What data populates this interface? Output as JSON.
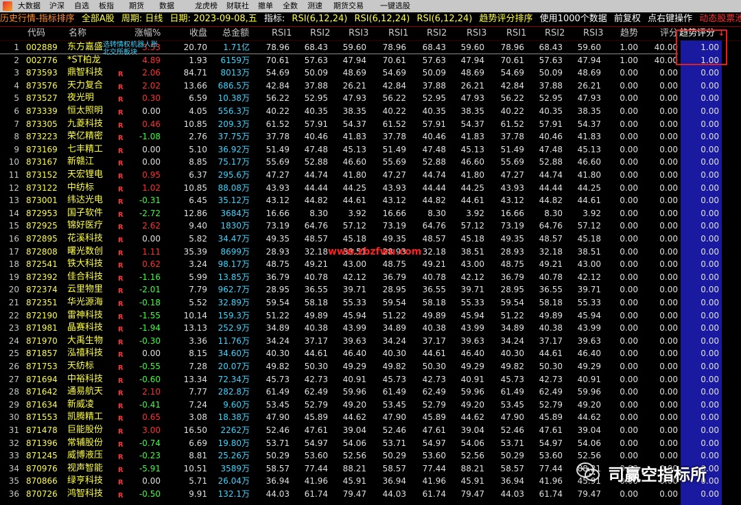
{
  "menu": [
    "大数据",
    "沪深",
    "自选",
    "板指",
    "期货",
    "数据",
    "龙虎榜",
    "财联社",
    "撤单",
    "全数",
    "测速",
    "期货交易",
    "一键选股"
  ],
  "title_bar": {
    "history": "历史行情-指标排序",
    "all_stocks": "全部A股",
    "period": "周期: 日线",
    "date": "日期: 2023-09-08,五",
    "indicator_label": "指标:",
    "ind1": "RSI(6,12,24)",
    "ind2": "RSI(6,12,24)",
    "ind3": "RSI(6,12,24)",
    "sort": "趋势评分排序",
    "use": "使用1000个数据",
    "adj": "前复权",
    "click": "点右键操作",
    "dynamic": "动态股票池"
  },
  "headers": {
    "code": "代码",
    "name": "名称",
    "change": "涨幅%",
    "close": "收盘",
    "amount": "总金额",
    "r1": "RSI1",
    "r2": "RSI2",
    "r3": "RSI3",
    "r4": "RSI1",
    "r5": "RSI2",
    "r6": "RSI3",
    "r7": "RSI1",
    "r8": "RSI2",
    "r9": "RSI3",
    "trend": "趋势",
    "score": "评分",
    "trend_score": "趋势评分",
    "sort_arrow": "↓"
  },
  "popup": {
    "line1": "选转情权机器人账",
    "line2": "北交所板块"
  },
  "watermark": "www.zbzfwu.com",
  "brand": "司赢空指标所",
  "colors": {
    "up": "#ff3030",
    "down": "#3aff3a",
    "highlight_col": "#1a1aa0",
    "code": "#ffff3a",
    "amount": "#3ad6ff"
  },
  "rows": [
    {
      "idx": "1",
      "code": "002889",
      "name": "东方嘉盛",
      "r": "",
      "chg": "3.53",
      "dir": "up",
      "close": "20.70",
      "amt": "1.71亿",
      "v": [
        "78.96",
        "68.43",
        "59.60",
        "78.96",
        "68.43",
        "59.60",
        "78.96",
        "68.43",
        "59.60"
      ],
      "trend": "1.00",
      "score": "40.00",
      "ts": "1.00"
    },
    {
      "idx": "2",
      "code": "002776",
      "name": "*ST柏龙",
      "r": "",
      "chg": "4.89",
      "dir": "up",
      "close": "1.93",
      "amt": "6159万",
      "v": [
        "70.61",
        "57.63",
        "47.94",
        "70.61",
        "57.63",
        "47.94",
        "70.61",
        "57.63",
        "47.94"
      ],
      "trend": "1.00",
      "score": "40.00",
      "ts": "1.00"
    },
    {
      "idx": "3",
      "code": "873593",
      "name": "鼎智科技",
      "r": "R",
      "chg": "2.06",
      "dir": "up",
      "close": "84.71",
      "amt": "8013万",
      "v": [
        "54.69",
        "50.09",
        "48.69",
        "54.69",
        "50.09",
        "48.69",
        "54.69",
        "50.09",
        "48.69"
      ],
      "trend": "0.00",
      "score": "0.00",
      "ts": "0.00"
    },
    {
      "idx": "4",
      "code": "873576",
      "name": "天力复合",
      "r": "R",
      "chg": "2.02",
      "dir": "up",
      "close": "13.66",
      "amt": "686.5万",
      "v": [
        "42.84",
        "37.88",
        "26.21",
        "42.84",
        "37.88",
        "26.21",
        "42.84",
        "37.88",
        "26.21"
      ],
      "trend": "0.00",
      "score": "0.00",
      "ts": "0.00"
    },
    {
      "idx": "5",
      "code": "873527",
      "name": "夜光明",
      "r": "R",
      "chg": "0.30",
      "dir": "up",
      "close": "6.59",
      "amt": "10.38万",
      "v": [
        "56.22",
        "52.95",
        "47.93",
        "56.22",
        "52.95",
        "47.93",
        "56.22",
        "52.95",
        "47.93"
      ],
      "trend": "0.00",
      "score": "0.00",
      "ts": "0.00"
    },
    {
      "idx": "6",
      "code": "873339",
      "name": "恒太照明",
      "r": "R",
      "chg": "0.00",
      "dir": "flat",
      "close": "4.05",
      "amt": "556.3万",
      "v": [
        "40.22",
        "40.35",
        "38.35",
        "40.22",
        "40.35",
        "38.35",
        "40.22",
        "40.35",
        "38.35"
      ],
      "trend": "0.00",
      "score": "0.00",
      "ts": "0.00"
    },
    {
      "idx": "7",
      "code": "873305",
      "name": "九菱科技",
      "r": "R",
      "chg": "0.46",
      "dir": "up",
      "close": "10.85",
      "amt": "209.3万",
      "v": [
        "61.52",
        "57.91",
        "54.37",
        "61.52",
        "57.91",
        "54.37",
        "61.52",
        "57.91",
        "54.37"
      ],
      "trend": "0.00",
      "score": "0.00",
      "ts": "0.00"
    },
    {
      "idx": "8",
      "code": "873223",
      "name": "荣亿精密",
      "r": "R",
      "chg": "-1.08",
      "dir": "down",
      "close": "2.76",
      "amt": "37.75万",
      "v": [
        "37.78",
        "40.46",
        "41.83",
        "37.78",
        "40.46",
        "41.83",
        "37.78",
        "40.46",
        "41.83"
      ],
      "trend": "0.00",
      "score": "0.00",
      "ts": "0.00"
    },
    {
      "idx": "9",
      "code": "873169",
      "name": "七丰精工",
      "r": "R",
      "chg": "0.00",
      "dir": "flat",
      "close": "5.10",
      "amt": "36.92万",
      "v": [
        "51.49",
        "47.48",
        "45.13",
        "51.49",
        "47.48",
        "45.13",
        "51.49",
        "47.48",
        "45.13"
      ],
      "trend": "0.00",
      "score": "0.00",
      "ts": "0.00"
    },
    {
      "idx": "10",
      "code": "873167",
      "name": "新赣江",
      "r": "R",
      "chg": "0.00",
      "dir": "flat",
      "close": "8.85",
      "amt": "75.17万",
      "v": [
        "55.69",
        "52.88",
        "46.60",
        "55.69",
        "52.88",
        "46.60",
        "55.69",
        "52.88",
        "46.60"
      ],
      "trend": "0.00",
      "score": "0.00",
      "ts": "0.00"
    },
    {
      "idx": "11",
      "code": "873152",
      "name": "天宏锂电",
      "r": "R",
      "chg": "0.95",
      "dir": "up",
      "close": "6.37",
      "amt": "295.6万",
      "v": [
        "47.27",
        "44.74",
        "41.80",
        "47.27",
        "44.74",
        "41.80",
        "47.27",
        "44.74",
        "41.80"
      ],
      "trend": "0.00",
      "score": "0.00",
      "ts": "0.00"
    },
    {
      "idx": "12",
      "code": "873122",
      "name": "中纺标",
      "r": "R",
      "chg": "1.02",
      "dir": "up",
      "close": "10.85",
      "amt": "88.08万",
      "v": [
        "43.93",
        "44.44",
        "44.25",
        "43.93",
        "44.44",
        "44.25",
        "43.93",
        "44.44",
        "44.25"
      ],
      "trend": "0.00",
      "score": "0.00",
      "ts": "0.00"
    },
    {
      "idx": "13",
      "code": "873001",
      "name": "纬达光电",
      "r": "R",
      "chg": "-0.31",
      "dir": "down",
      "close": "6.45",
      "amt": "35.12万",
      "v": [
        "43.12",
        "44.82",
        "44.61",
        "43.12",
        "44.82",
        "44.61",
        "43.12",
        "44.82",
        "44.61"
      ],
      "trend": "0.00",
      "score": "0.00",
      "ts": "0.00"
    },
    {
      "idx": "14",
      "code": "872953",
      "name": "国子软件",
      "r": "R",
      "chg": "-2.72",
      "dir": "down",
      "close": "12.86",
      "amt": "3684万",
      "v": [
        "16.66",
        "8.30",
        "3.92",
        "16.66",
        "8.30",
        "3.92",
        "16.66",
        "8.30",
        "3.92"
      ],
      "trend": "0.00",
      "score": "0.00",
      "ts": "0.00"
    },
    {
      "idx": "15",
      "code": "872925",
      "name": "锦好医疗",
      "r": "R",
      "chg": "2.62",
      "dir": "up",
      "close": "9.40",
      "amt": "1830万",
      "v": [
        "73.19",
        "64.76",
        "57.12",
        "73.19",
        "64.76",
        "57.12",
        "73.19",
        "64.76",
        "57.12"
      ],
      "trend": "0.00",
      "score": "0.00",
      "ts": "0.00"
    },
    {
      "idx": "16",
      "code": "872895",
      "name": "花溪科技",
      "r": "R",
      "chg": "0.00",
      "dir": "flat",
      "close": "5.82",
      "amt": "34.47万",
      "v": [
        "49.35",
        "48.57",
        "45.18",
        "49.35",
        "48.57",
        "45.18",
        "49.35",
        "48.57",
        "45.18"
      ],
      "trend": "0.00",
      "score": "0.00",
      "ts": "0.00"
    },
    {
      "idx": "17",
      "code": "872808",
      "name": "曙光数创",
      "r": "R",
      "chg": "1.11",
      "dir": "up",
      "close": "35.39",
      "amt": "8699万",
      "v": [
        "28.93",
        "32.18",
        "38.51",
        "28.93",
        "32.18",
        "38.51",
        "28.93",
        "32.18",
        "38.51"
      ],
      "trend": "0.00",
      "score": "0.00",
      "ts": "0.00"
    },
    {
      "idx": "18",
      "code": "872541",
      "name": "铁大科技",
      "r": "R",
      "chg": "0.62",
      "dir": "up",
      "close": "3.24",
      "amt": "98.17万",
      "v": [
        "48.75",
        "49.21",
        "43.00",
        "48.75",
        "49.21",
        "43.00",
        "48.75",
        "49.21",
        "43.00"
      ],
      "trend": "0.00",
      "score": "0.00",
      "ts": "0.00"
    },
    {
      "idx": "19",
      "code": "872392",
      "name": "佳合科技",
      "r": "R",
      "chg": "-1.16",
      "dir": "down",
      "close": "5.99",
      "amt": "13.85万",
      "v": [
        "36.79",
        "40.78",
        "42.12",
        "36.79",
        "40.78",
        "42.12",
        "36.79",
        "40.78",
        "42.12"
      ],
      "trend": "0.00",
      "score": "0.00",
      "ts": "0.00"
    },
    {
      "idx": "20",
      "code": "872374",
      "name": "云里物里",
      "r": "R",
      "chg": "-2.01",
      "dir": "down",
      "close": "7.79",
      "amt": "962.7万",
      "v": [
        "28.95",
        "36.55",
        "39.71",
        "28.95",
        "36.55",
        "39.71",
        "28.95",
        "36.55",
        "39.71"
      ],
      "trend": "0.00",
      "score": "0.00",
      "ts": "0.00"
    },
    {
      "idx": "21",
      "code": "872351",
      "name": "华光源海",
      "r": "R",
      "chg": "-0.18",
      "dir": "down",
      "close": "5.52",
      "amt": "32.89万",
      "v": [
        "59.54",
        "58.18",
        "55.33",
        "59.54",
        "58.18",
        "55.33",
        "59.54",
        "58.18",
        "55.33"
      ],
      "trend": "0.00",
      "score": "0.00",
      "ts": "0.00"
    },
    {
      "idx": "22",
      "code": "872190",
      "name": "雷神科技",
      "r": "R",
      "chg": "-1.55",
      "dir": "down",
      "close": "10.14",
      "amt": "159.3万",
      "v": [
        "51.22",
        "49.89",
        "45.94",
        "51.22",
        "49.89",
        "45.94",
        "51.22",
        "49.89",
        "45.94"
      ],
      "trend": "0.00",
      "score": "0.00",
      "ts": "0.00"
    },
    {
      "idx": "23",
      "code": "871981",
      "name": "晶赛科技",
      "r": "R",
      "chg": "-1.94",
      "dir": "down",
      "close": "13.13",
      "amt": "252.9万",
      "v": [
        "34.89",
        "40.38",
        "43.99",
        "34.89",
        "40.38",
        "43.99",
        "34.89",
        "40.38",
        "43.99"
      ],
      "trend": "0.00",
      "score": "0.00",
      "ts": "0.00"
    },
    {
      "idx": "24",
      "code": "871970",
      "name": "大禹生物",
      "r": "R",
      "chg": "-0.30",
      "dir": "down",
      "close": "3.36",
      "amt": "11.76万",
      "v": [
        "34.24",
        "37.17",
        "39.63",
        "34.24",
        "37.17",
        "39.63",
        "34.24",
        "37.17",
        "39.63"
      ],
      "trend": "0.00",
      "score": "0.00",
      "ts": "0.00"
    },
    {
      "idx": "25",
      "code": "871857",
      "name": "泓禧科技",
      "r": "R",
      "chg": "0.00",
      "dir": "flat",
      "close": "8.15",
      "amt": "34.60万",
      "v": [
        "40.30",
        "44.61",
        "46.40",
        "40.30",
        "44.61",
        "46.40",
        "40.30",
        "44.61",
        "46.40"
      ],
      "trend": "0.00",
      "score": "0.00",
      "ts": "0.00"
    },
    {
      "idx": "26",
      "code": "871753",
      "name": "天纺标",
      "r": "R",
      "chg": "-0.55",
      "dir": "down",
      "close": "7.28",
      "amt": "20.07万",
      "v": [
        "49.82",
        "50.30",
        "49.29",
        "49.82",
        "50.30",
        "49.29",
        "49.82",
        "50.30",
        "49.29"
      ],
      "trend": "0.00",
      "score": "0.00",
      "ts": "0.00"
    },
    {
      "idx": "27",
      "code": "871694",
      "name": "中裕科技",
      "r": "R",
      "chg": "-0.60",
      "dir": "down",
      "close": "13.34",
      "amt": "72.34万",
      "v": [
        "45.73",
        "42.73",
        "40.91",
        "45.73",
        "42.73",
        "40.91",
        "45.73",
        "42.73",
        "40.91"
      ],
      "trend": "0.00",
      "score": "0.00",
      "ts": "0.00"
    },
    {
      "idx": "28",
      "code": "871642",
      "name": "通易航天",
      "r": "R",
      "chg": "2.10",
      "dir": "up",
      "close": "7.77",
      "amt": "282.8万",
      "v": [
        "61.49",
        "62.49",
        "59.96",
        "61.49",
        "62.49",
        "59.96",
        "61.49",
        "62.49",
        "59.96"
      ],
      "trend": "0.00",
      "score": "0.00",
      "ts": "0.00"
    },
    {
      "idx": "29",
      "code": "871634",
      "name": "新威凌",
      "r": "R",
      "chg": "-0.41",
      "dir": "down",
      "close": "7.24",
      "amt": "9.60万",
      "v": [
        "53.45",
        "52.79",
        "49.20",
        "53.45",
        "52.79",
        "49.20",
        "53.45",
        "52.79",
        "49.20"
      ],
      "trend": "0.00",
      "score": "0.00",
      "ts": "0.00"
    },
    {
      "idx": "30",
      "code": "871553",
      "name": "凯腾精工",
      "r": "R",
      "chg": "0.65",
      "dir": "up",
      "close": "3.08",
      "amt": "18.38万",
      "v": [
        "47.90",
        "45.89",
        "44.62",
        "47.90",
        "45.89",
        "44.62",
        "47.90",
        "45.89",
        "44.62"
      ],
      "trend": "0.00",
      "score": "0.00",
      "ts": "0.00"
    },
    {
      "idx": "31",
      "code": "871478",
      "name": "巨能股份",
      "r": "R",
      "chg": "3.00",
      "dir": "up",
      "close": "16.50",
      "amt": "2262万",
      "v": [
        "52.46",
        "47.61",
        "39.04",
        "52.46",
        "47.61",
        "39.04",
        "52.46",
        "47.61",
        "39.04"
      ],
      "trend": "0.00",
      "score": "0.00",
      "ts": "0.00"
    },
    {
      "idx": "32",
      "code": "871396",
      "name": "常辅股份",
      "r": "R",
      "chg": "-0.74",
      "dir": "down",
      "close": "6.69",
      "amt": "19.80万",
      "v": [
        "53.71",
        "54.97",
        "54.06",
        "53.71",
        "54.97",
        "54.06",
        "53.71",
        "54.97",
        "54.06"
      ],
      "trend": "0.00",
      "score": "0.00",
      "ts": "0.00"
    },
    {
      "idx": "33",
      "code": "871245",
      "name": "威博液压",
      "r": "R",
      "chg": "-0.23",
      "dir": "down",
      "close": "8.81",
      "amt": "25.26万",
      "v": [
        "50.29",
        "53.60",
        "52.56",
        "50.29",
        "53.60",
        "52.56",
        "50.29",
        "53.60",
        "52.56"
      ],
      "trend": "0.00",
      "score": "0.00",
      "ts": "0.00"
    },
    {
      "idx": "34",
      "code": "870976",
      "name": "视声智能",
      "r": "R",
      "chg": "-5.91",
      "dir": "down",
      "close": "10.51",
      "amt": "3589万",
      "v": [
        "58.57",
        "77.44",
        "88.21",
        "58.57",
        "77.44",
        "88.21",
        "58.57",
        "77.44",
        "88.21"
      ],
      "trend": "0.00",
      "score": "0.00",
      "ts": "0.00"
    },
    {
      "idx": "35",
      "code": "870866",
      "name": "绿亨科技",
      "r": "R",
      "chg": "0.00",
      "dir": "flat",
      "close": "5.71",
      "amt": "26.04万",
      "v": [
        "36.94",
        "41.96",
        "45.91",
        "36.94",
        "41.96",
        "45.91",
        "36.94",
        "41.96",
        "45.91"
      ],
      "trend": "0.00",
      "score": "0.00",
      "ts": "0.00"
    },
    {
      "idx": "36",
      "code": "870726",
      "name": "鸿智科技",
      "r": "R",
      "chg": "-0.50",
      "dir": "down",
      "close": "9.91",
      "amt": "132.1万",
      "v": [
        "44.03",
        "61.74",
        "79.47",
        "44.03",
        "61.74",
        "79.47",
        "44.03",
        "61.74",
        "79.47"
      ],
      "trend": "0.00",
      "score": "0.00",
      "ts": "0.00"
    }
  ]
}
